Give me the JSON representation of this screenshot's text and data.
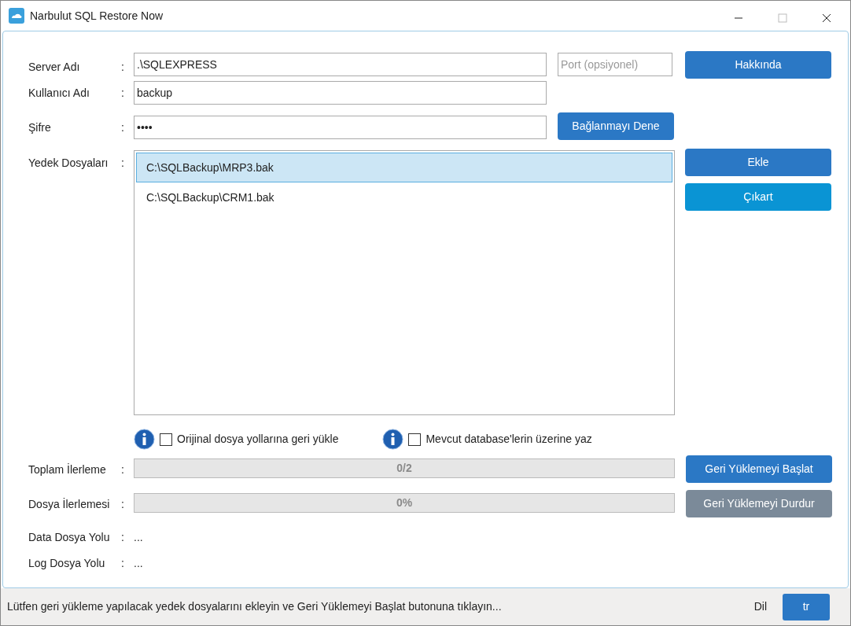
{
  "window": {
    "title": "Narbulut SQL Restore Now"
  },
  "connection": {
    "server": {
      "label": "Server Adı",
      "separator": ":",
      "value": ".\\SQLEXPRESS"
    },
    "port": {
      "placeholder": "Port (opsiyonel)"
    },
    "user": {
      "label": "Kullanıcı Adı",
      "separator": ":",
      "value": "backup"
    },
    "password": {
      "label": "Şifre",
      "separator": ":",
      "value": "••••"
    },
    "about_button": {
      "label": "Hakkında"
    },
    "test_button": {
      "label": "Bağlanmayı Dene"
    }
  },
  "backup_files": {
    "label": "Yedek Dosyaları",
    "separator": ":",
    "items": [
      {
        "path": "C:\\SQLBackup\\MRP3.bak",
        "selected": true
      },
      {
        "path": "C:\\SQLBackup\\CRM1.bak",
        "selected": false
      }
    ],
    "buttons": [
      {
        "label": "Ekle",
        "hovered": false
      },
      {
        "label": "Çıkart",
        "hovered": true
      }
    ]
  },
  "options": [
    {
      "label": "Orijinal dosya yollarına geri yükle",
      "checked": false
    },
    {
      "label": "Mevcut database'lerin üzerine yaz",
      "checked": false
    }
  ],
  "progress": [
    {
      "label": "Toplam İlerleme",
      "separator": ":",
      "reading": "0/2",
      "level": 0,
      "button": {
        "label": "Geri Yüklemeyi Başlat",
        "disabled": false
      }
    },
    {
      "label": "Dosya İlerlemesi",
      "separator": ":",
      "reading": "0%",
      "level": 0,
      "button": {
        "label": "Geri Yüklemeyi Durdur",
        "disabled": true
      }
    }
  ],
  "paths": [
    {
      "label": "Data Dosya Yolu",
      "separator": ":",
      "value": "..."
    },
    {
      "label": "Log Dosya Yolu",
      "separator": ":",
      "value": "..."
    }
  ],
  "status_bar": {
    "message": "Lütfen geri yükleme yapılacak yedek dosyalarını ekleyin ve Geri Yüklemeyi Başlat butonuna tıklayın...",
    "language_label": "Dil",
    "language_button": "tr"
  }
}
